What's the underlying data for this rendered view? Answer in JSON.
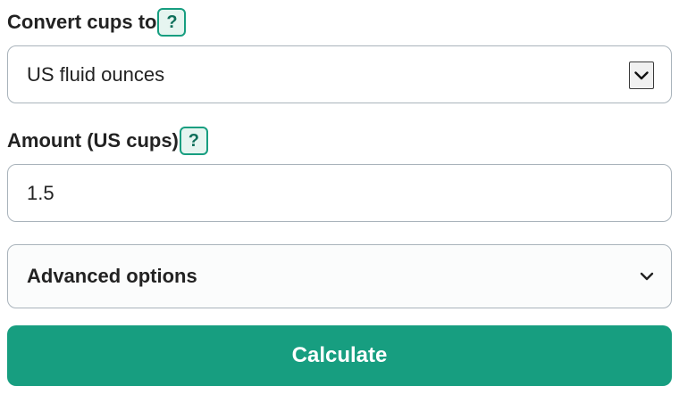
{
  "convert": {
    "label": "Convert cups to",
    "help": "?",
    "selected": "US fluid ounces"
  },
  "amount": {
    "label": "Amount (US cups)",
    "help": "?",
    "value": "1.5"
  },
  "advanced": {
    "label": "Advanced options"
  },
  "calculate": {
    "label": "Calculate"
  },
  "colors": {
    "accent": "#179e80",
    "help_bg": "#e6f5f0",
    "border": "#a9b3bb",
    "text": "#222222"
  },
  "icons": {
    "select_arrow": "chevron-down-icon",
    "advanced_toggle": "chevron-down-icon"
  }
}
